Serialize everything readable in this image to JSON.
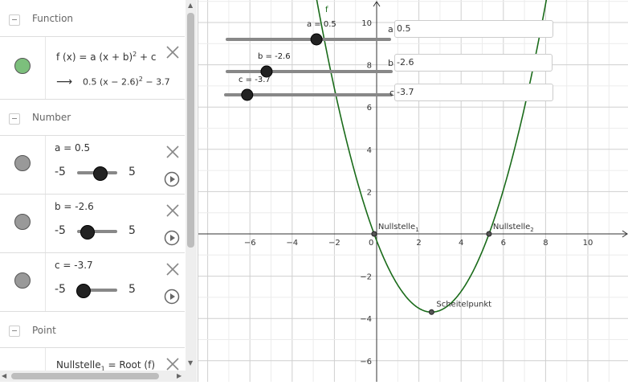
{
  "algebra": {
    "groups": {
      "function": "Function",
      "number": "Number",
      "point": "Point"
    },
    "function_item": {
      "definition_prefix": "f (x) = a  (x + b)",
      "definition_exp": "2",
      "definition_suffix": " + c",
      "arrow": "⟶",
      "result_prefix": "0.5  (x − 2.6)",
      "result_exp": "2",
      "result_suffix": " − 3.7",
      "color": "#7cbf7c"
    },
    "numbers": [
      {
        "label": "a = 0.5",
        "min": "-5",
        "max": "5",
        "value": 0.5
      },
      {
        "label": "b = -2.6",
        "min": "-5",
        "max": "5",
        "value": -2.6
      },
      {
        "label": "c = -3.7",
        "min": "-5",
        "max": "5",
        "value": -3.7
      }
    ],
    "point_item": {
      "text_prefix": "Nullstelle",
      "text_suffix": " = Root (f)"
    },
    "marker_gray": "#999999"
  },
  "graphics": {
    "sliders": [
      {
        "label": "a = 0.5",
        "value": 0.5,
        "min": -5,
        "max": 5,
        "input_label": "a",
        "input_value": "0.5"
      },
      {
        "label": "b = -2.6",
        "value": -2.6,
        "min": -5,
        "max": 5,
        "input_label": "b",
        "input_value": "-2.6"
      },
      {
        "label": "c = -3.7",
        "value": -3.7,
        "min": -5,
        "max": 5,
        "input_label": "c",
        "input_value": "-3.7"
      }
    ],
    "function_label": "f",
    "curve_color": "#1a6b1a",
    "x_ticks": [
      "−6",
      "−4",
      "−2",
      "0",
      "2",
      "4",
      "6",
      "8",
      "10"
    ],
    "y_ticks": [
      "10",
      "8",
      "6",
      "4",
      "2",
      "−2",
      "−4",
      "−6"
    ],
    "points": [
      {
        "name": "Nullstelle",
        "sub": "1",
        "x": -0.12
      },
      {
        "name": "Nullstelle",
        "sub": "2",
        "x": 5.32
      },
      {
        "name": "Scheitelpunkt",
        "sub": "",
        "x": 2.6,
        "y": -3.7
      }
    ]
  }
}
